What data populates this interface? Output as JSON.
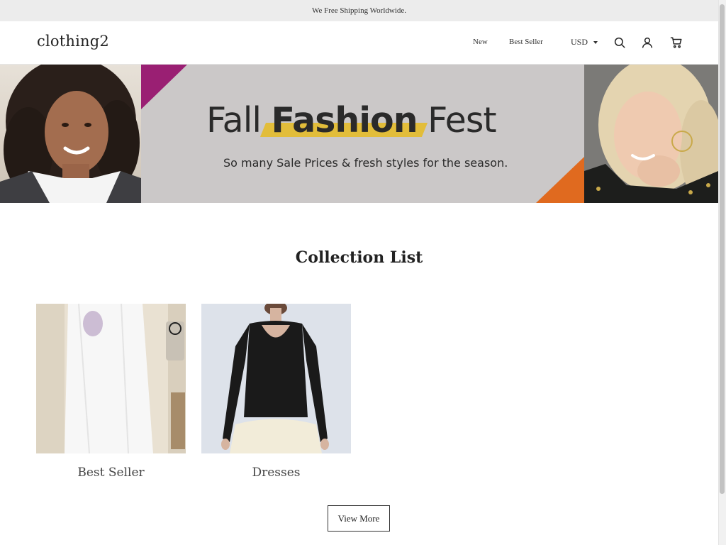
{
  "announcement": {
    "text": "We Free Shipping Worldwide."
  },
  "header": {
    "logo": "clothing2",
    "nav": [
      {
        "label": "New"
      },
      {
        "label": "Best Seller"
      }
    ],
    "currency": "USD",
    "icons": [
      "search-icon",
      "account-icon",
      "cart-icon"
    ]
  },
  "hero": {
    "title_part1": "Fall",
    "title_part2": "Fashion",
    "title_part3": "Fest",
    "subtitle": "So many Sale Prices & fresh styles for the season.",
    "colors": {
      "purple": "#9a1f73",
      "orange": "#e06a1f",
      "highlight": "#e2bd3a",
      "background": "#cbc8c8"
    }
  },
  "collection": {
    "title": "Collection List",
    "items": [
      {
        "label": "Best Seller"
      },
      {
        "label": "Dresses"
      }
    ],
    "view_more": "View More"
  }
}
